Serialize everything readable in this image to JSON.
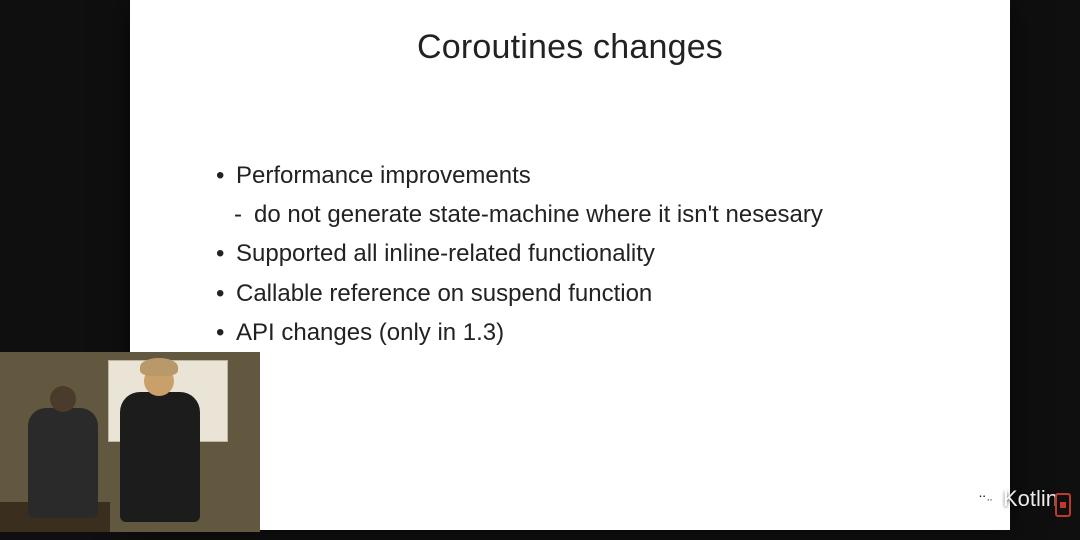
{
  "slide": {
    "title": "Coroutines changes",
    "bullets": [
      "Performance improvements",
      "do not generate state-machine where it isn't nesesary",
      "Supported all inline-related functionality",
      "Callable reference on suspend function",
      "API changes (only in 1.3)"
    ]
  },
  "watermark": {
    "label": "Kotlin"
  }
}
